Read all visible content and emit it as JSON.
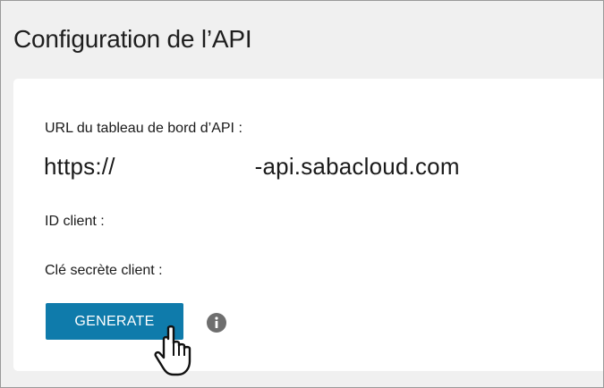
{
  "header": {
    "title": "Configuration de l’API"
  },
  "form": {
    "url_label": "URL du tableau de bord d’API :",
    "url_prefix": "https://",
    "url_suffix": "-api.sabacloud.com",
    "client_id_label": "ID client :",
    "client_secret_label": "Clé secrète client :",
    "generate_label": "GENERATE"
  },
  "icons": {
    "info": "info-icon",
    "cursor": "hand-pointer-cursor"
  },
  "colors": {
    "primary_button": "#0f7bab",
    "info_icon": "#6e6e6e",
    "page_background": "#f0f0f0",
    "card_background": "#ffffff"
  }
}
